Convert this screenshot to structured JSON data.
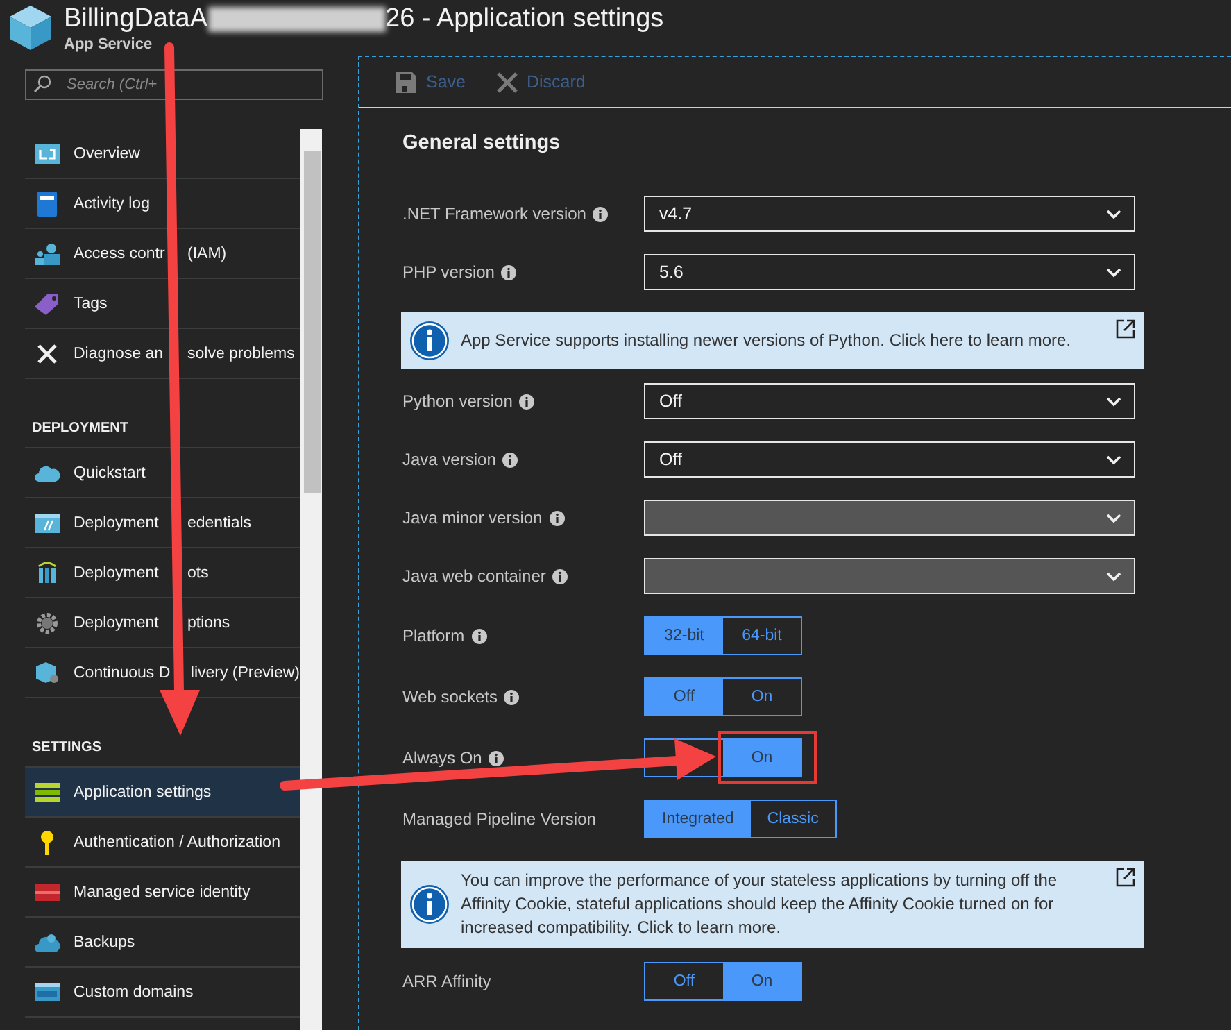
{
  "header": {
    "title_start": "BillingDataA",
    "title_end": "26 - Application settings",
    "subtitle": "App Service"
  },
  "sidebar": {
    "search": {
      "placeholder": "Search (Ctrl+"
    },
    "sections": [
      {
        "items": [
          {
            "label": [
              "Overview"
            ],
            "selected": false
          },
          {
            "label": [
              "Activity log"
            ],
            "selected": false
          },
          {
            "label": [
              "Access contr",
              "(IAM)"
            ],
            "selected": false
          },
          {
            "label": [
              "Tags"
            ],
            "selected": false
          },
          {
            "label": [
              "Diagnose an",
              "solve problems"
            ],
            "selected": false
          }
        ]
      },
      {
        "heading": "DEPLOYMENT",
        "items": [
          {
            "label": [
              "Quickstart"
            ],
            "selected": false
          },
          {
            "label": [
              "Deployment",
              "edentials"
            ],
            "selected": false
          },
          {
            "label": [
              "Deployment",
              "ots"
            ],
            "selected": false
          },
          {
            "label": [
              "Deployment",
              "ptions"
            ],
            "selected": false
          },
          {
            "label": [
              "Continuous D",
              "livery (Preview)"
            ],
            "selected": false
          }
        ]
      },
      {
        "heading": "SETTINGS",
        "items": [
          {
            "label": [
              "Application settings"
            ],
            "selected": true
          },
          {
            "label": [
              "Authentication / Authorization"
            ],
            "selected": false
          },
          {
            "label": [
              "Managed service identity"
            ],
            "selected": false
          },
          {
            "label": [
              "Backups"
            ],
            "selected": false
          },
          {
            "label": [
              "Custom domains"
            ],
            "selected": false
          }
        ]
      }
    ]
  },
  "toolbar": [
    {
      "label": "Save",
      "kind": "save",
      "disabled": true
    },
    {
      "label": "Discard",
      "kind": "discard",
      "disabled": true
    }
  ],
  "settings": {
    "heading": "General settings",
    "rows": [
      {
        "kind": "dropdown",
        "label": ".NET Framework version",
        "info": true,
        "value": "v4.7",
        "disabled": false
      },
      {
        "kind": "dropdown",
        "label": "PHP version",
        "info": true,
        "value": "5.6",
        "disabled": false
      },
      {
        "kind": "notice",
        "text": "App Service supports installing newer versions of Python. Click here to learn more."
      },
      {
        "kind": "dropdown",
        "label": "Python version",
        "info": true,
        "value": "Off",
        "disabled": false
      },
      {
        "kind": "dropdown",
        "label": "Java version",
        "info": true,
        "value": "Off",
        "disabled": false
      },
      {
        "kind": "dropdown",
        "label": "Java minor version",
        "info": true,
        "disabled": true
      },
      {
        "kind": "dropdown",
        "label": "Java web container",
        "info": true,
        "disabled": true
      },
      {
        "kind": "toggle",
        "label": "Platform",
        "info": true,
        "options": [
          {
            "label": "32-bit",
            "selected": true
          },
          {
            "label": "64-bit",
            "selected": false
          }
        ]
      },
      {
        "kind": "toggle",
        "label": "Web sockets",
        "info": true,
        "options": [
          {
            "label": "Off",
            "selected": true
          },
          {
            "label": "On",
            "selected": false
          }
        ]
      },
      {
        "kind": "toggle",
        "label": "Always On",
        "info": true,
        "options": [
          {
            "selected": false
          },
          {
            "label": "On",
            "selected": true
          }
        ]
      },
      {
        "kind": "toggle",
        "label": "Managed Pipeline Version",
        "info": false,
        "options": [
          {
            "label": "Integrated",
            "selected": true
          },
          {
            "label": "Classic",
            "selected": false
          }
        ]
      },
      {
        "kind": "notice",
        "text": "You can improve the performance of your stateless applications by turning off the Affinity Cookie, stateful applications should keep the Affinity Cookie turned on for increased compatibility. Click to learn more."
      },
      {
        "kind": "toggle",
        "label": "ARR Affinity",
        "info": false,
        "options": [
          {
            "label": "Off",
            "selected": false
          },
          {
            "label": "On",
            "selected": true
          }
        ]
      }
    ]
  }
}
